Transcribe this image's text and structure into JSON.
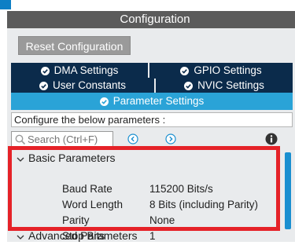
{
  "panel": {
    "title": "Configuration",
    "reset_button": "Reset Configuration"
  },
  "tabs": [
    {
      "label": "DMA Settings"
    },
    {
      "label": "GPIO Settings"
    },
    {
      "label": "User Constants"
    },
    {
      "label": "NVIC Settings"
    },
    {
      "label": "Parameter Settings"
    }
  ],
  "configure_text": "Configure the below parameters :",
  "search": {
    "placeholder": "Search (Ctrl+F)"
  },
  "sections": {
    "basic": {
      "label": "Basic Parameters",
      "params": [
        {
          "label": "Baud Rate",
          "value": "115200 Bits/s"
        },
        {
          "label": "Word Length",
          "value": "8 Bits (including Parity)"
        },
        {
          "label": "Parity",
          "value": "None"
        },
        {
          "label": "Stop Bits",
          "value": "1"
        }
      ]
    },
    "advanced": {
      "label": "Advanced Parameters"
    }
  },
  "colors": {
    "tab_dark": "#0b2b4b",
    "tab_active": "#2aa3d7",
    "highlight": "#e52228",
    "accent_blue": "#1a8fd0"
  },
  "icons": [
    "check-circle-icon",
    "search-icon",
    "arrow-left-circle-icon",
    "arrow-right-circle-icon",
    "info-icon",
    "chevron-down-icon"
  ]
}
